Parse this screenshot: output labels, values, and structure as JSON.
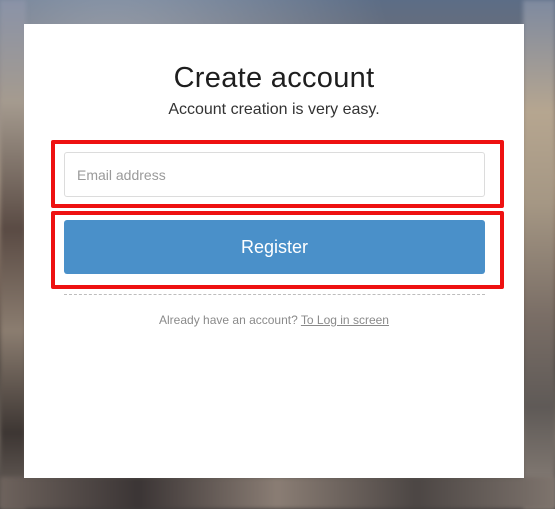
{
  "form": {
    "title": "Create account",
    "subtitle": "Account creation is very easy.",
    "email_placeholder": "Email address",
    "email_value": "",
    "register_label": "Register",
    "login_prompt": "Already have an account?",
    "login_link": "To Log in screen"
  },
  "colors": {
    "accent": "#4a90c9",
    "highlight": "#ee1111"
  }
}
